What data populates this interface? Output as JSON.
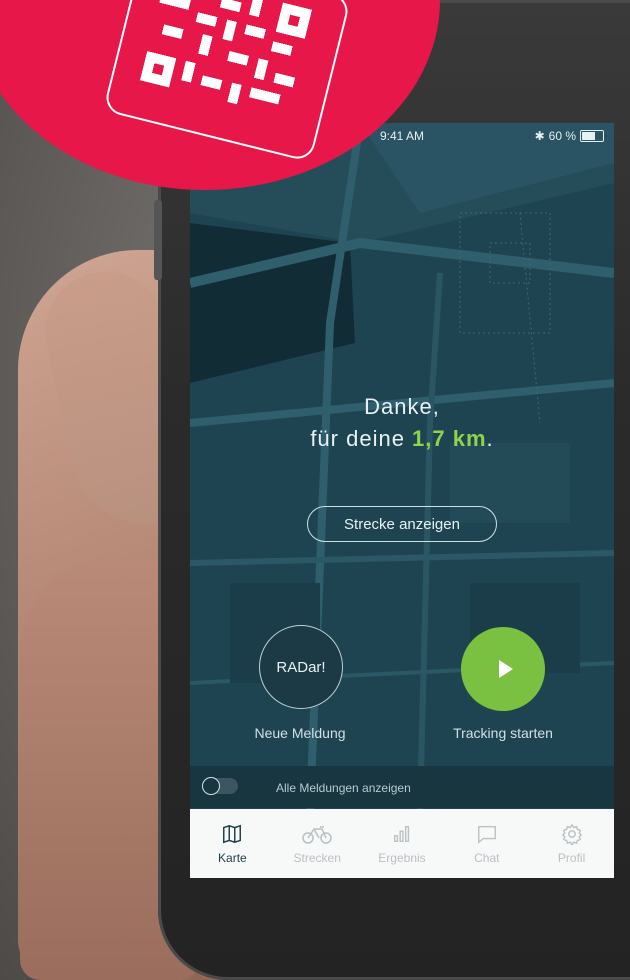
{
  "status": {
    "time": "9:41 AM",
    "battery": "60 %"
  },
  "hero": {
    "line1": "Danke,",
    "line2_prefix": "für deine ",
    "distance": "1,7 km",
    "line2_suffix": "."
  },
  "route_button": "Strecke anzeigen",
  "radar_button": "RADar!",
  "radar_label": "Neue Meldung",
  "tracking_label": "Tracking starten",
  "toggle_label": "Alle Meldungen anzeigen",
  "tabs": [
    {
      "label": "Karte",
      "icon": "map-icon",
      "active": true
    },
    {
      "label": "Strecken",
      "icon": "bicycle-icon",
      "active": false
    },
    {
      "label": "Ergebnis",
      "icon": "bar-chart-icon",
      "active": false
    },
    {
      "label": "Chat",
      "icon": "chat-icon",
      "active": false
    },
    {
      "label": "Profil",
      "icon": "gear-icon",
      "active": false
    }
  ],
  "colors": {
    "accent_green": "#7ac141",
    "brand_red": "#e8174a",
    "map_bg": "#1f4451"
  }
}
